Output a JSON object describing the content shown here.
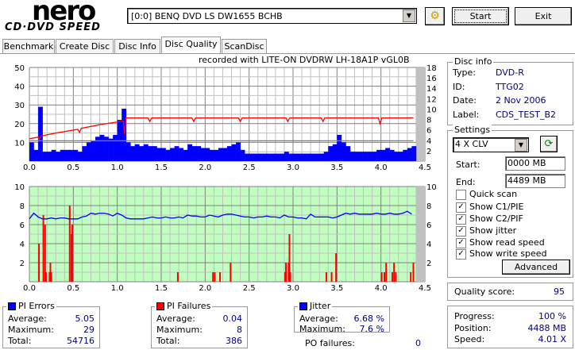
{
  "header": {
    "logo_top": "nero",
    "logo_bottom": "CD·DVD SPEED",
    "drive": "[0:0]  BENQ DVD LS DW1655 BCHB",
    "start": "Start",
    "exit": "Exit"
  },
  "tabs": [
    {
      "label": "Benchmark"
    },
    {
      "label": "Create Disc"
    },
    {
      "label": "Disc Info"
    },
    {
      "label": "Disc Quality",
      "active": true
    },
    {
      "label": "ScanDisc"
    }
  ],
  "chart_caption": "recorded with LITE-ON DVDRW LH-18A1P   vGL0B",
  "disc_info": {
    "title": "Disc info",
    "type_label": "Type:",
    "type": "DVD-R",
    "id_label": "ID:",
    "id": "TTG02",
    "date_label": "Date:",
    "date": "2 Nov 2006",
    "label_label": "Label:",
    "label": "CDS_TEST_B2"
  },
  "settings": {
    "title": "Settings",
    "speed": "4 X CLV",
    "start_label": "Start:",
    "start": "0000 MB",
    "end_label": "End:",
    "end": "4489 MB",
    "checks": [
      {
        "label": "Quick scan",
        "checked": false
      },
      {
        "label": "Show C1/PIE",
        "checked": true
      },
      {
        "label": "Show C2/PIF",
        "checked": true
      },
      {
        "label": "Show jitter",
        "checked": true
      },
      {
        "label": "Show read speed",
        "checked": true
      },
      {
        "label": "Show write speed",
        "checked": true
      }
    ],
    "advanced": "Advanced"
  },
  "quality": {
    "label": "Quality score:",
    "value": "95"
  },
  "progress": {
    "progress_label": "Progress:",
    "progress": "100 %",
    "position_label": "Position:",
    "position": "4488 MB",
    "speed_label": "Speed:",
    "speed": "4.01 X"
  },
  "pi_errors": {
    "title": "PI Errors",
    "color": "#0000ff",
    "avg_label": "Average:",
    "avg": "5.05",
    "max_label": "Maximum:",
    "max": "29",
    "total_label": "Total:",
    "total": "54716"
  },
  "pi_failures": {
    "title": "PI Failures",
    "color": "#ff0000",
    "avg_label": "Average:",
    "avg": "0.04",
    "max_label": "Maximum:",
    "max": "8",
    "total_label": "Total:",
    "total": "386"
  },
  "jitter": {
    "title": "Jitter",
    "color": "#0000ff",
    "avg_label": "Average:",
    "avg": "6.68 %",
    "max_label": "Maximum:",
    "max": "7.6 %",
    "po_label": "PO failures:",
    "po": "0"
  },
  "chart_data": [
    {
      "type": "bar",
      "name": "PI errors / speed",
      "xlim": [
        0,
        4.5
      ],
      "ylim": [
        0,
        50
      ],
      "y2lim": [
        0,
        18
      ],
      "xticks": [
        "0.0",
        "0.5",
        "1.0",
        "1.5",
        "2.0",
        "2.5",
        "3.0",
        "3.5",
        "4.0",
        "4.5"
      ],
      "yticks": [
        "10",
        "20",
        "30",
        "40",
        "50"
      ],
      "y2ticks": [
        "2",
        "4",
        "6",
        "8",
        "10",
        "12",
        "14",
        "16",
        "18"
      ],
      "pie_step": 0.05,
      "pie": [
        10,
        6,
        29,
        5,
        5,
        6,
        5,
        6,
        6,
        6,
        6,
        5,
        8,
        10,
        11,
        13,
        14,
        13,
        12,
        14,
        22,
        28,
        10,
        8,
        9,
        8,
        9,
        8,
        8,
        7,
        7,
        6,
        7,
        8,
        7,
        6,
        9,
        8,
        8,
        7,
        7,
        6,
        6,
        7,
        7,
        8,
        9,
        10,
        6,
        4,
        4,
        4,
        4,
        4,
        4,
        4,
        4,
        4,
        5,
        4,
        4,
        4,
        4,
        4,
        4,
        4,
        4,
        5,
        8,
        9,
        14,
        10,
        8,
        5,
        5,
        5,
        5,
        5,
        5,
        6,
        6,
        7,
        6,
        5,
        5,
        6,
        7,
        8
      ],
      "read_speed": [
        [
          0,
          4.3
        ],
        [
          0.1,
          4.6
        ],
        [
          0.11,
          4.2
        ],
        [
          0.13,
          4.8
        ],
        [
          0.3,
          5.4
        ],
        [
          0.55,
          6.1
        ],
        [
          0.57,
          5.5
        ],
        [
          0.59,
          6.3
        ],
        [
          0.8,
          7.0
        ],
        [
          1.07,
          7.7
        ],
        [
          1.08,
          5.2
        ],
        [
          1.1,
          8.3
        ],
        [
          1.35,
          8.3
        ],
        [
          1.37,
          7.6
        ],
        [
          1.39,
          8.3
        ],
        [
          1.85,
          8.3
        ],
        [
          1.87,
          7.6
        ],
        [
          1.89,
          8.3
        ],
        [
          2.38,
          8.3
        ],
        [
          2.4,
          7.6
        ],
        [
          2.42,
          8.3
        ],
        [
          2.92,
          8.3
        ],
        [
          2.94,
          7.6
        ],
        [
          2.96,
          8.3
        ],
        [
          3.32,
          8.3
        ],
        [
          3.34,
          7.6
        ],
        [
          3.36,
          8.3
        ],
        [
          3.97,
          8.3
        ],
        [
          3.99,
          7.2
        ],
        [
          4.01,
          8.3
        ],
        [
          4.37,
          8.3
        ]
      ],
      "write_speed": [
        [
          0,
          3.9
        ],
        [
          4.37,
          3.9
        ]
      ]
    },
    {
      "type": "bar",
      "name": "PI failures / jitter",
      "xlim": [
        0,
        4.5
      ],
      "ylim": [
        0,
        10
      ],
      "y2lim": [
        0,
        10
      ],
      "xticks": [
        "0.0",
        "0.5",
        "1.0",
        "1.5",
        "2.0",
        "2.5",
        "3.0",
        "3.5",
        "4.0",
        "4.5"
      ],
      "yticks": [
        "2",
        "4",
        "6",
        "8",
        "10"
      ],
      "y2ticks": [
        "2",
        "4",
        "6",
        "8",
        "10"
      ],
      "pif": [
        [
          0.1,
          4
        ],
        [
          0.15,
          7
        ],
        [
          0.17,
          6
        ],
        [
          0.18,
          1
        ],
        [
          0.22,
          1
        ],
        [
          0.23,
          2
        ],
        [
          0.24,
          1
        ],
        [
          0.45,
          8
        ],
        [
          0.47,
          5
        ],
        [
          0.48,
          6
        ],
        [
          1.68,
          1
        ],
        [
          2.08,
          1
        ],
        [
          2.1,
          1
        ],
        [
          2.16,
          1
        ],
        [
          2.28,
          2
        ],
        [
          2.9,
          1
        ],
        [
          2.91,
          2
        ],
        [
          2.94,
          2
        ],
        [
          2.95,
          5
        ],
        [
          2.96,
          1
        ],
        [
          3.37,
          1
        ],
        [
          3.43,
          1
        ],
        [
          3.48,
          3
        ],
        [
          4.0,
          1
        ],
        [
          4.03,
          1
        ],
        [
          4.05,
          2
        ],
        [
          4.12,
          1
        ],
        [
          4.14,
          2
        ],
        [
          4.16,
          1
        ],
        [
          4.33,
          1
        ],
        [
          4.36,
          2
        ]
      ],
      "jitter_step": 0.05,
      "jitter": [
        6.6,
        7.2,
        6.8,
        6.6,
        6.6,
        6.7,
        6.6,
        6.7,
        6.7,
        6.6,
        6.6,
        6.6,
        6.8,
        6.9,
        7.2,
        7.1,
        7.2,
        7.2,
        7.1,
        6.9,
        7.2,
        7.0,
        6.7,
        6.6,
        6.6,
        6.6,
        6.6,
        6.7,
        6.8,
        6.7,
        6.7,
        6.8,
        6.7,
        6.7,
        6.8,
        6.7,
        7.0,
        6.9,
        6.9,
        6.8,
        6.8,
        7.0,
        6.9,
        6.8,
        7.0,
        7.1,
        7.1,
        7.0,
        6.9,
        6.8,
        6.8,
        6.7,
        6.8,
        6.8,
        6.9,
        6.8,
        6.8,
        6.7,
        7.0,
        6.8,
        6.8,
        6.7,
        6.7,
        6.6,
        7.1,
        6.8,
        6.8,
        6.8,
        6.8,
        6.7,
        6.8,
        7.0,
        7.2,
        7.1,
        7.2,
        7.1,
        7.1,
        7.1,
        7.1,
        7.2,
        7.1,
        7.1,
        7.2,
        7.1,
        7.1,
        7.2,
        7.4,
        7.1
      ]
    }
  ]
}
